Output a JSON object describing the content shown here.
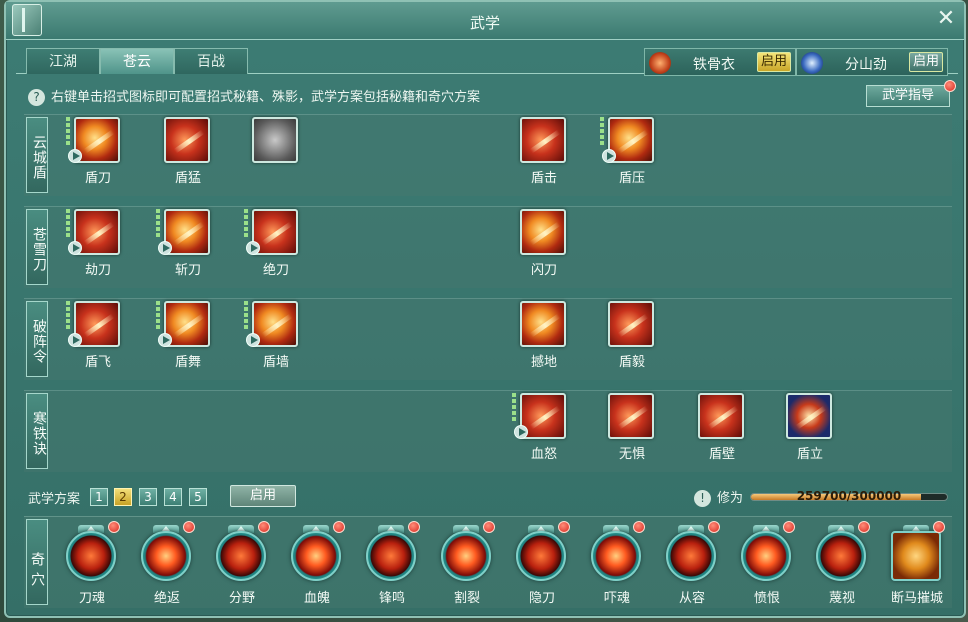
{
  "window": {
    "title": "武学"
  },
  "tabs": [
    {
      "label": "江湖"
    },
    {
      "label": "苍云"
    },
    {
      "label": "百战"
    }
  ],
  "stances": [
    {
      "name": "铁骨衣",
      "button": "启用"
    },
    {
      "name": "分山劲",
      "button": "启用"
    }
  ],
  "help_text": "右键单击招式图标即可配置招式秘籍、殊影，武学方案包括秘籍和奇穴方案",
  "guide_button": "武学指导",
  "rows": [
    {
      "label": "云城盾",
      "skills": [
        {
          "label": "盾刀"
        },
        {
          "label": "盾猛"
        },
        {
          "label": ""
        },
        {
          "label": "盾击"
        },
        {
          "label": "盾压"
        }
      ]
    },
    {
      "label": "苍雪刀",
      "skills": [
        {
          "label": "劫刀"
        },
        {
          "label": "斩刀"
        },
        {
          "label": "绝刀"
        },
        {
          "label": "闪刀"
        }
      ]
    },
    {
      "label": "破阵令",
      "skills": [
        {
          "label": "盾飞"
        },
        {
          "label": "盾舞"
        },
        {
          "label": "盾墙"
        },
        {
          "label": "撼地"
        },
        {
          "label": "盾毅"
        }
      ]
    },
    {
      "label": "寒铁诀",
      "skills": [
        {
          "label": "血怒"
        },
        {
          "label": "无惧"
        },
        {
          "label": "盾壁"
        },
        {
          "label": "盾立"
        }
      ]
    }
  ],
  "plan": {
    "label": "武学方案",
    "numbers": [
      "1",
      "2",
      "3",
      "4",
      "5"
    ],
    "selected": "2",
    "apply_button": "启用"
  },
  "cultivation": {
    "label": "修为",
    "text": "259700/300000",
    "progress": 0.8657
  },
  "qixue": {
    "label": "奇穴",
    "items": [
      {
        "label": "刀魂"
      },
      {
        "label": "绝返"
      },
      {
        "label": "分野"
      },
      {
        "label": "血魄"
      },
      {
        "label": "锋鸣"
      },
      {
        "label": "割裂"
      },
      {
        "label": "隐刀"
      },
      {
        "label": "吓魂"
      },
      {
        "label": "从容"
      },
      {
        "label": "愤恨"
      },
      {
        "label": "蔑视"
      },
      {
        "label": "断马摧城"
      }
    ]
  },
  "colors": {
    "panel": "#356f67",
    "accent_gold": "#f3e07a",
    "alert_red": "#d8281e"
  },
  "icons": {
    "close": "close-icon",
    "help": "question-icon",
    "warning": "exclamation-icon"
  }
}
